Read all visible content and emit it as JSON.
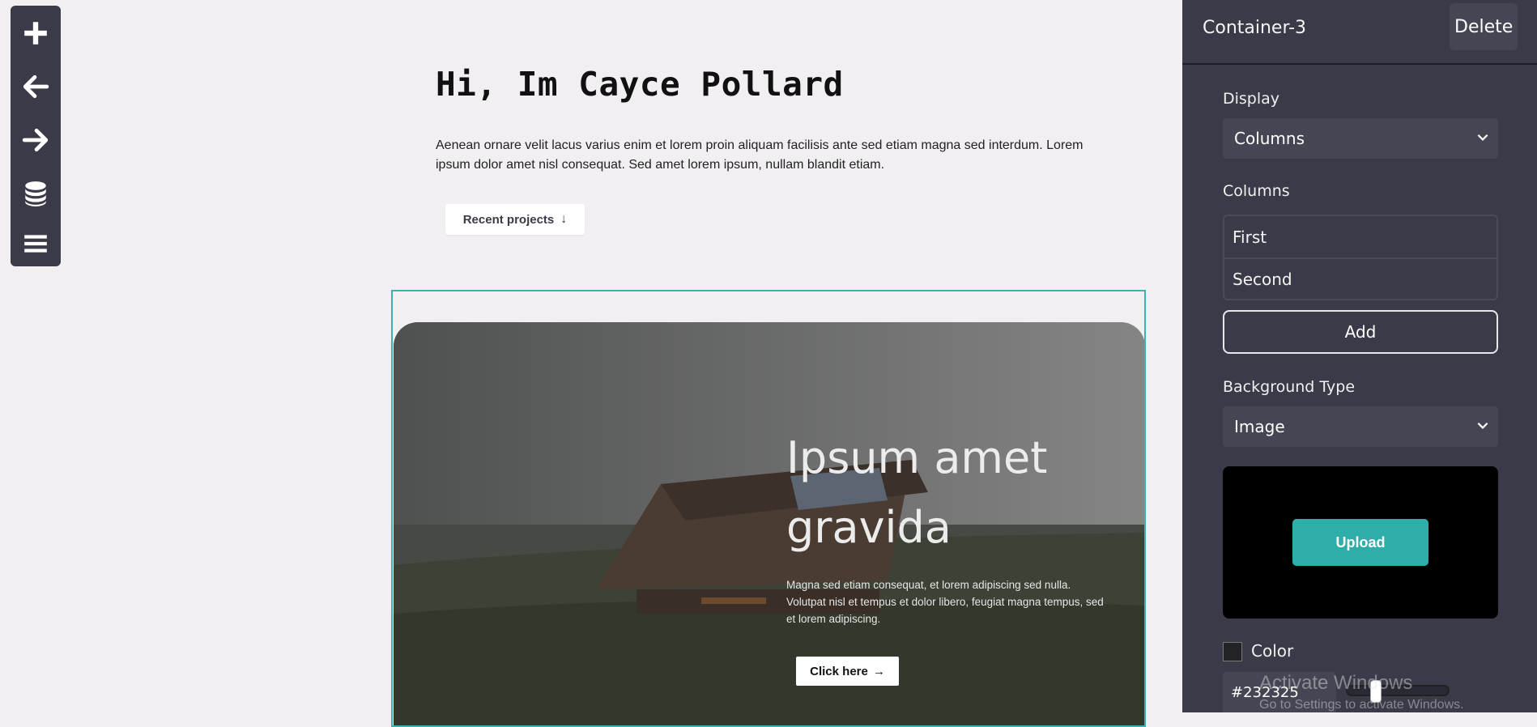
{
  "toolbar": {
    "items": [
      {
        "icon": "plus-icon"
      },
      {
        "icon": "arrow-left-icon"
      },
      {
        "icon": "arrow-right-icon"
      },
      {
        "icon": "database-icon"
      },
      {
        "icon": "menu-icon"
      }
    ]
  },
  "canvas": {
    "hero_title": "Hi, Im Cayce Pollard",
    "hero_text": "Aenean ornare velit lacus varius enim et lorem proin aliquam facilisis ante sed etiam magna sed interdum. Lorem ipsum dolor amet nisl consequat. Sed amet lorem ipsum, nullam blandit etiam.",
    "recent_button": "Recent projects",
    "recent_arrow": "↓",
    "card": {
      "title": "Ipsum amet gravida",
      "text": "Magna sed etiam consequat, et lorem adipiscing sed nulla. Volutpat nisl et tempus et dolor libero, feugiat magna tempus, sed et lorem adipiscing.",
      "button": "Click here",
      "button_arrow": "→"
    },
    "selection_color": "#3fb1ac"
  },
  "panel": {
    "title": "Container-3",
    "delete": "Delete",
    "display_label": "Display",
    "display_value": "Columns",
    "columns_label": "Columns",
    "columns": [
      "First",
      "Second"
    ],
    "add": "Add",
    "background_label": "Background Type",
    "background_value": "Image",
    "upload": "Upload",
    "color_label": "Color",
    "color_hex": "#232325",
    "opacity_fraction": 0.25,
    "accent": "#2fada8"
  },
  "watermark": {
    "line1": "Activate Windows",
    "line2": "Go to Settings to activate Windows."
  }
}
